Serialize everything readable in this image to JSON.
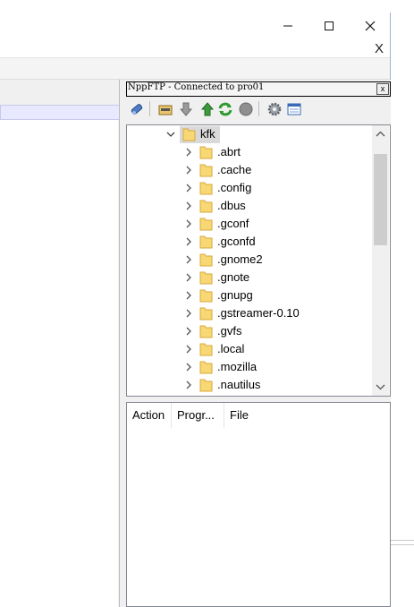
{
  "window": {
    "caption_buttons": [
      "minimize",
      "maximize",
      "close"
    ],
    "menu_close_label": "X"
  },
  "ftp_panel": {
    "title": "NppFTP - Connected to pro01",
    "close_label": "x",
    "toolbar": [
      {
        "name": "connect-icon"
      },
      {
        "name": "open-folder-icon"
      },
      {
        "name": "download-icon"
      },
      {
        "name": "upload-icon"
      },
      {
        "name": "refresh-icon"
      },
      {
        "name": "abort-icon"
      },
      {
        "name": "settings-icon"
      },
      {
        "name": "message-window-icon"
      }
    ],
    "tree": {
      "root": "kfk",
      "folders": [
        ".abrt",
        ".cache",
        ".config",
        ".dbus",
        ".gconf",
        ".gconfd",
        ".gnome2",
        ".gnote",
        ".gnupg",
        ".gstreamer-0.10",
        ".gvfs",
        ".local",
        ".mozilla",
        ".nautilus"
      ]
    },
    "queue": {
      "columns": [
        "Action",
        "Progr...",
        "File"
      ]
    }
  },
  "colors": {
    "folder_fill": "#f8d775",
    "folder_edge": "#d9a93a",
    "selection": "#d9d9d9",
    "window_border": "#9bb5d4"
  }
}
